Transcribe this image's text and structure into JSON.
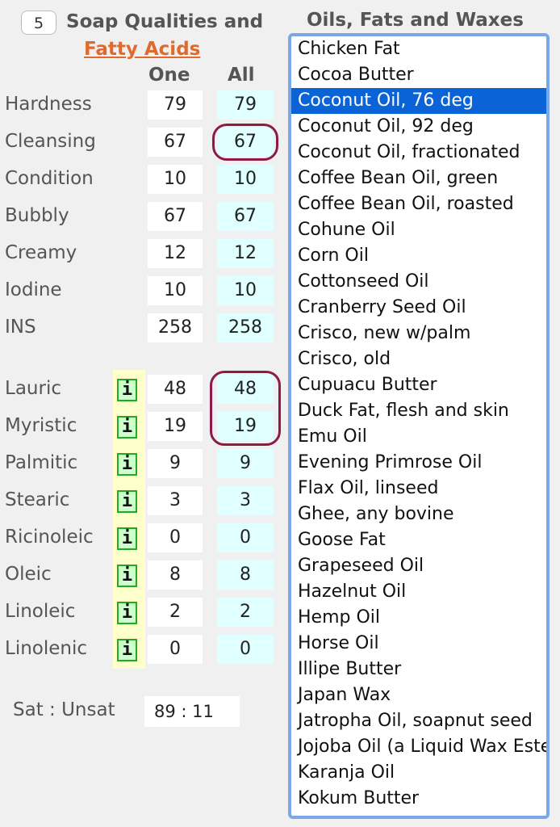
{
  "header": {
    "step": "5",
    "title": "Soap Qualities and",
    "link": "Fatty Acids"
  },
  "columns": {
    "one": "One",
    "all": "All"
  },
  "qualities": [
    {
      "label": "Hardness",
      "one": "79",
      "all": "79"
    },
    {
      "label": "Cleansing",
      "one": "67",
      "all": "67"
    },
    {
      "label": "Condition",
      "one": "10",
      "all": "10"
    },
    {
      "label": "Bubbly",
      "one": "67",
      "all": "67"
    },
    {
      "label": "Creamy",
      "one": "12",
      "all": "12"
    },
    {
      "label": "Iodine",
      "one": "10",
      "all": "10"
    },
    {
      "label": "INS",
      "one": "258",
      "all": "258"
    }
  ],
  "fatty_acids": [
    {
      "label": "Lauric",
      "info": "i",
      "one": "48",
      "all": "48"
    },
    {
      "label": "Myristic",
      "info": "i",
      "one": "19",
      "all": "19"
    },
    {
      "label": "Palmitic",
      "info": "i",
      "one": "9",
      "all": "9"
    },
    {
      "label": "Stearic",
      "info": "i",
      "one": "3",
      "all": "3"
    },
    {
      "label": "Ricinoleic",
      "info": "i",
      "one": "0",
      "all": "0"
    },
    {
      "label": "Oleic",
      "info": "i",
      "one": "8",
      "all": "8"
    },
    {
      "label": "Linoleic",
      "info": "i",
      "one": "2",
      "all": "2"
    },
    {
      "label": "Linolenic",
      "info": "i",
      "one": "0",
      "all": "0"
    }
  ],
  "sat_unsat": {
    "label": "Sat : Unsat",
    "value": "89 : 11"
  },
  "oils": {
    "heading": "Oils, Fats and Waxes",
    "selected": "Coconut Oil, 76 deg",
    "items": [
      "Chicken Fat",
      "Cocoa Butter",
      "Coconut Oil, 76 deg",
      "Coconut Oil, 92 deg",
      "Coconut Oil, fractionated",
      "Coffee Bean Oil, green",
      "Coffee Bean Oil, roasted",
      "Cohune Oil",
      "Corn Oil",
      "Cottonseed Oil",
      "Cranberry Seed Oil",
      "Crisco, new w/palm",
      "Crisco, old",
      "Cupuacu Butter",
      "Duck Fat, flesh and skin",
      "Emu Oil",
      "Evening Primrose Oil",
      "Flax Oil, linseed",
      "Ghee, any bovine",
      "Goose Fat",
      "Grapeseed Oil",
      "Hazelnut Oil",
      "Hemp Oil",
      "Horse Oil",
      "Illipe Butter",
      "Japan Wax",
      "Jatropha Oil, soapnut seed",
      "Jojoba Oil (a Liquid Wax Ester)",
      "Karanja Oil",
      "Kokum Butter"
    ]
  },
  "colors": {
    "accent_link": "#e06a2c",
    "highlight_ring": "#8b1c48",
    "selection": "#0a64d8",
    "info_button": "#ccffcc"
  }
}
